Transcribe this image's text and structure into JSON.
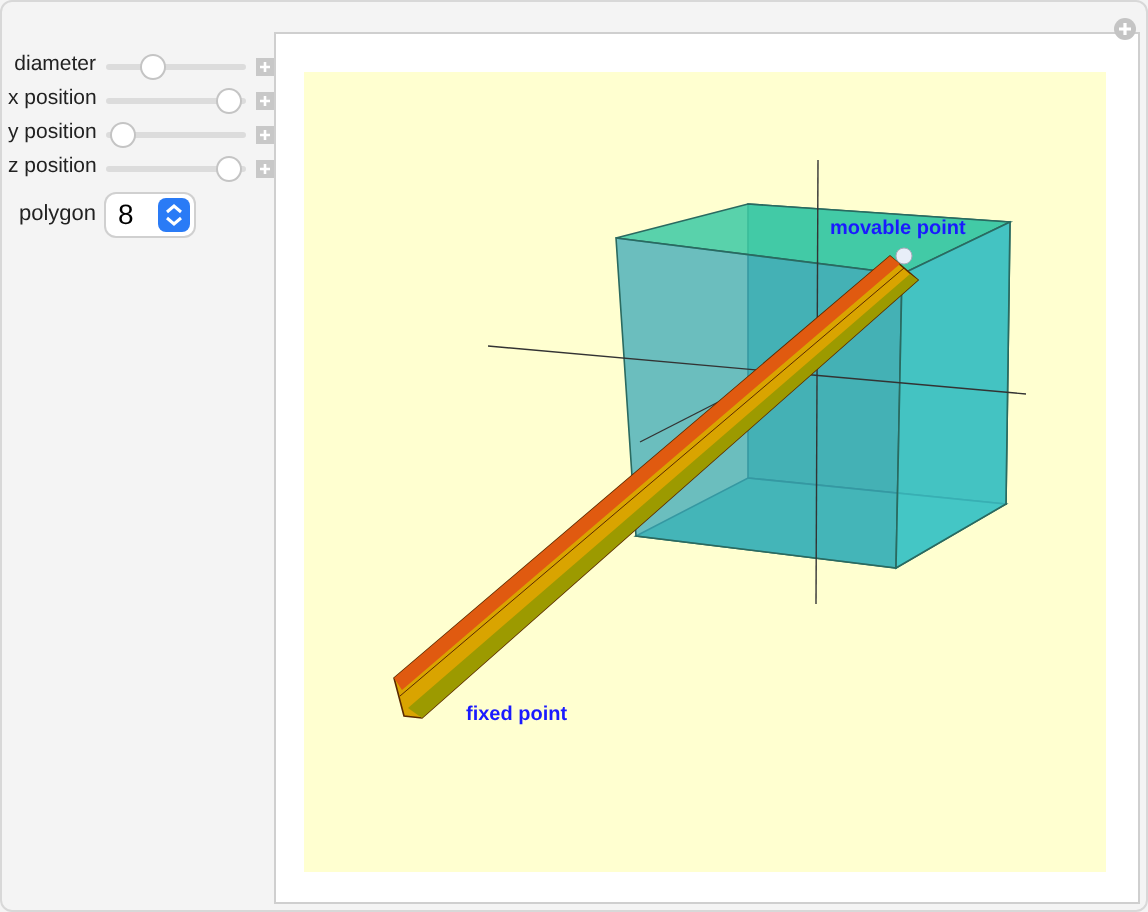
{
  "controls": [
    {
      "label": "diameter",
      "level": 0.3
    },
    {
      "label": "x position",
      "level": 0.95
    },
    {
      "label": "y position",
      "level": 0.05
    },
    {
      "label": "z position",
      "level": 0.95
    }
  ],
  "polygon": {
    "label": "polygon",
    "value": "8"
  },
  "plot": {
    "labels": [
      {
        "kind": "movable",
        "text": "movable point"
      },
      {
        "kind": "fixed",
        "text": "fixed point"
      }
    ]
  }
}
